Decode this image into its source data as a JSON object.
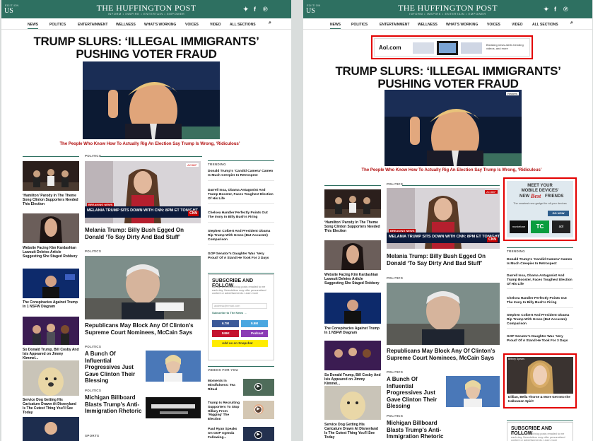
{
  "header": {
    "edition_label": "EDITION",
    "edition": "US",
    "brand": "THE HUFFINGTON POST",
    "tagline": "INFORM • INSPIRE • ENTERTAIN • EMPOWER",
    "social": [
      "twitter",
      "facebook",
      "pinterest"
    ]
  },
  "nav": [
    "NEWS",
    "POLITICS",
    "ENTERTAINMENT",
    "WELLNESS",
    "WHAT'S WORKING",
    "VOICES",
    "VIDEO",
    "ALL SECTIONS"
  ],
  "headline": {
    "line1": "TRUMP SLURS: ‘ILLEGAL IMMIGRANTS’",
    "line2": "PUSHING VOTER FRAUD",
    "subhead": "The People Who Know How To Actually Rig An Election Say Trump Is Wrong, ‘Ridiculous’",
    "photo_badge": "Reuters"
  },
  "sections": {
    "politics": "POLITICS",
    "trending": "TRENDING",
    "sports": "SPORTS",
    "videos": "VIDEOS FOR YOU"
  },
  "left_column": [
    "‘Hamilton’ Parody In The Theme Song Clinton Supporters Needed This Election",
    "Website Facing Kim Kardashian Lawsuit Deletes Article Suggesting She Staged Robbery",
    "The Conspiracies Against Trump In 1 NSFW Diagram",
    "So Donald Trump, Bill Cosby And Isis Appeared on Jimmy Kimmel...",
    "Service Dog Getting His Caricature Drawn At Disneyland Is The Cutest Thing You'll See Today"
  ],
  "melania": {
    "breaking": "BREAKING NEWS",
    "bar": "MELANIA TRUMP SITS DOWN WITH CNN: 8PM ET TONIGHT",
    "network": "CNN",
    "live": "AC360°",
    "title": "Melania Trump: Billy Bush Egged On Donald ‘To Say Dirty And Bad Stuff’"
  },
  "mccain": {
    "title": "Republicans May Block Any Of Clinton's Supreme Court Nominees, McCain Says"
  },
  "progressives": {
    "title": "A Bunch Of Influential Progressives Just Gave Clinton Their Blessing"
  },
  "billboard": {
    "title": "Michigan Billboard Blasts Trump's Anti-Immigration Rhetoric"
  },
  "trending": [
    "Donald Trump's ‘Candid Camera’ Cameo Is Much Creepier In Retrospect",
    "Darrell Issa, Obama Antagonist And Trump Booster, Faces Toughest Election Of His Life",
    "Chelsea Handler Perfectly Points Out The Irony In Billy Bush's Firing",
    "Stephen Colbert And President Obama Rip Trump With Gross (But Accurate) Comparison",
    "GOP Senator's Daughter Was ‘Very Proud’ Of A Stand He Took For 3 Days"
  ],
  "subscribe": {
    "title": "SUBSCRIBE AND FOLLOW",
    "text": "Get top stories and blog posts emailed to me each day. Newsletters may offer personalized content or advertisements. Learn more",
    "email_placeholder": "address@email.com",
    "link": "Subscribe to The News →",
    "facebook": "6.7M",
    "twitter": "9.9M",
    "instagram": "Podcast",
    "pinterest": "849K",
    "snapchat": "Add us on Snapchat"
  },
  "videos": [
    "Moments in Mindfulness: Tea Ritual",
    "Trump Is Recruiting Supporters To Stop Hillary From ‘Rigging’ The Election",
    "Paul Ryan Speaks On GOP Agenda Following..."
  ],
  "ads": {
    "aol_logo": "Aol.com",
    "aol_text": "Breaking news alerts trending videos, and more",
    "mobile_line1": "MEET YOUR",
    "mobile_line2": "MOBILE DEVICES'",
    "mobile_line3": "NEW",
    "mobile_best": "Best",
    "mobile_line4": "FRIENDS",
    "mobile_small": "The smartest new gadget for all your devices",
    "mobile_btn": "GO NOW",
    "mobile_brands": [
      "moviefone",
      "TC",
      "aol"
    ],
    "celeb_caption": "Britney Spears",
    "celeb_title": "Dillian, Bella Thorne & More Get Into the Halloween Spirit"
  },
  "right_col_order": [
    "‘Hamilton’ Parody In The Theme Song Clinton Supporters Needed This Election"
  ],
  "colors": {
    "brand_green": "#2e7061",
    "headline_red": "#b00c0c",
    "highlight_red": "#e30000"
  }
}
